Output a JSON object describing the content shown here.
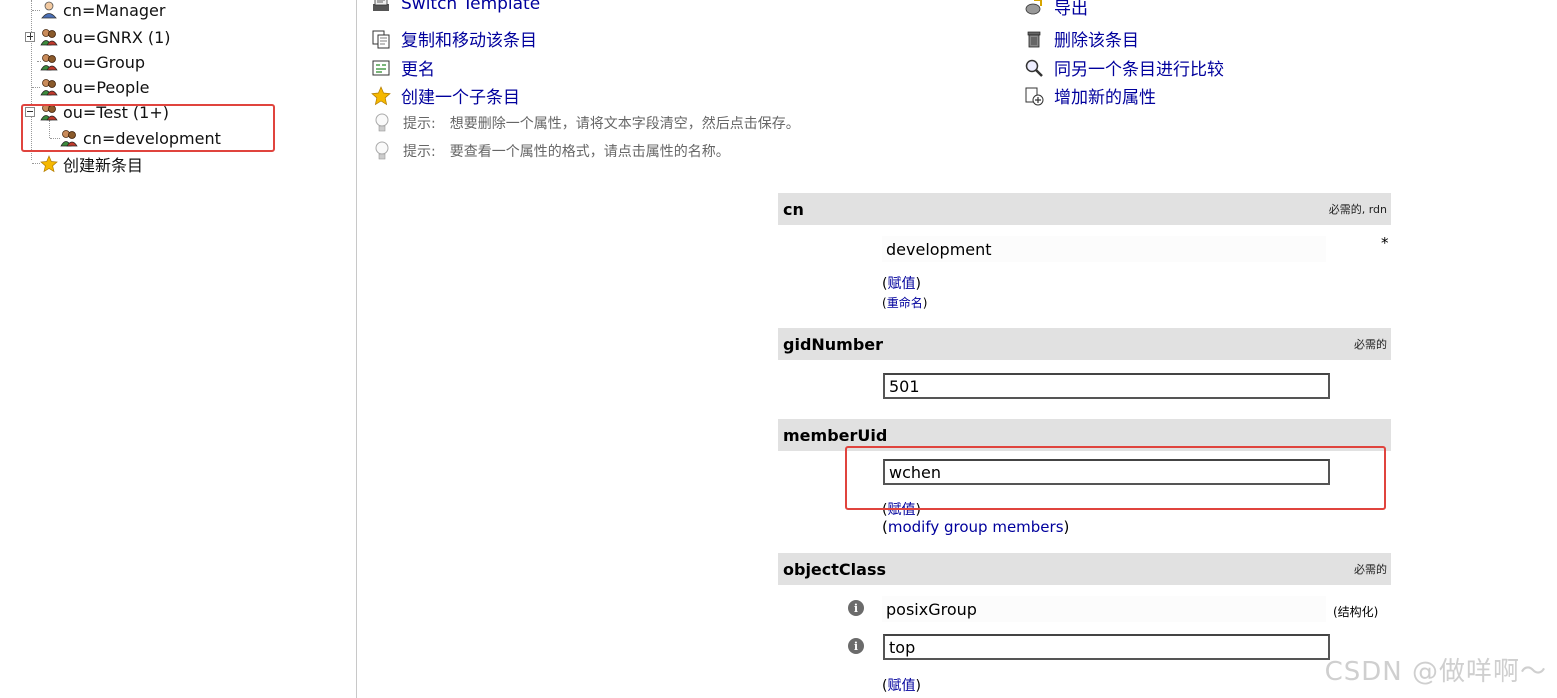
{
  "tree": {
    "nodes": [
      {
        "label": "cn=Manager"
      },
      {
        "label": "ou=GNRX (1)"
      },
      {
        "label": "ou=Group"
      },
      {
        "label": "ou=People"
      },
      {
        "label": "ou=Test (1+)"
      },
      {
        "label": "cn=development"
      },
      {
        "label": "创建新条目"
      }
    ]
  },
  "actions": {
    "switch_template": "Switch Template",
    "copy_move": "复制和移动该条目",
    "rename": "更名",
    "create_child": "创建一个子条目",
    "export": "导出",
    "delete": "删除该条目",
    "compare": "同另一个条目进行比较",
    "add_attribute": "增加新的属性"
  },
  "hints": [
    {
      "label": "提示:",
      "text": "想要删除一个属性，请将文本字段清空，然后点击保存。"
    },
    {
      "label": "提示:",
      "text": "要查看一个属性的格式，请点击属性的名称。"
    }
  ],
  "attributes": {
    "cn": {
      "name": "cn",
      "flag": "必需的, rdn",
      "value": "development",
      "required_mark": "*",
      "link_add": "赋值",
      "link_rename": "重命名"
    },
    "gidNumber": {
      "name": "gidNumber",
      "flag": "必需的",
      "value": "501"
    },
    "memberUid": {
      "name": "memberUid",
      "value": "wchen",
      "link_add": "赋值",
      "link_modify": "modify group members"
    },
    "objectClass": {
      "name": "objectClass",
      "flag": "必需的",
      "value1": "posixGroup",
      "structural": "(结构化)",
      "value2": "top",
      "link_add": "赋值"
    }
  },
  "watermark": "CSDN @做咩啊～",
  "colors": {
    "link": "#00009c",
    "header_bg": "#e1e1e1",
    "highlight": "#e0443e"
  }
}
